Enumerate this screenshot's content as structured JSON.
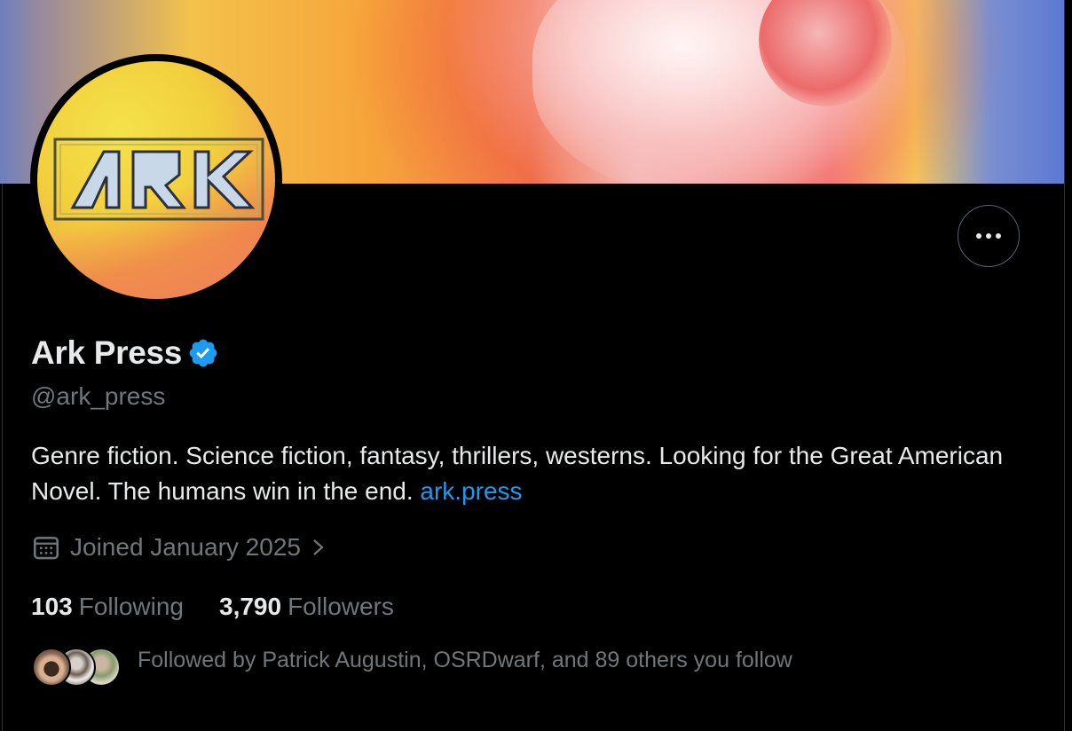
{
  "profile": {
    "avatar_text": "ARK",
    "display_name": "Ark Press",
    "handle": "@ark_press",
    "bio_text": "Genre fiction. Science fiction, fantasy, thrillers, westerns. Looking for the Great American Novel. The humans win in the end. ",
    "bio_link": "ark.press",
    "joined": "Joined January 2025",
    "following_count": "103",
    "following_label": "Following",
    "followers_count": "3,790",
    "followers_label": "Followers",
    "followed_by": "Followed by Patrick Augustin, OSRDwarf, and 89 others you follow"
  },
  "icons": {
    "verified": "verified-badge-icon",
    "more": "more-options-icon",
    "calendar": "calendar-icon",
    "chevron": "chevron-right-icon"
  },
  "colors": {
    "accent": "#1d9bf0",
    "text_primary": "#e7e9ea",
    "text_secondary": "#71767b",
    "background": "#000000"
  }
}
